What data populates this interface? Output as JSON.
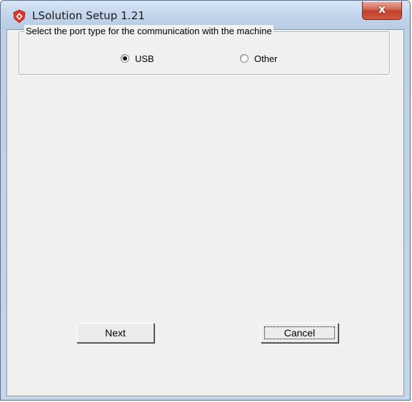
{
  "window": {
    "title": "LSolution Setup 1.21",
    "close_label": "x"
  },
  "port_group": {
    "label": "Select the port type for the communication with the machine",
    "options": [
      {
        "label": "USB",
        "selected": true
      },
      {
        "label": "Other",
        "selected": false
      }
    ]
  },
  "buttons": {
    "next_label": "Next",
    "cancel_label": "Cancel"
  },
  "colors": {
    "app_icon": "#e2342b",
    "close_button": "#c3402b",
    "dialog_background": "#f0f0f0"
  },
  "icons": {
    "app": "lsolution-app-icon",
    "close": "close-icon"
  }
}
